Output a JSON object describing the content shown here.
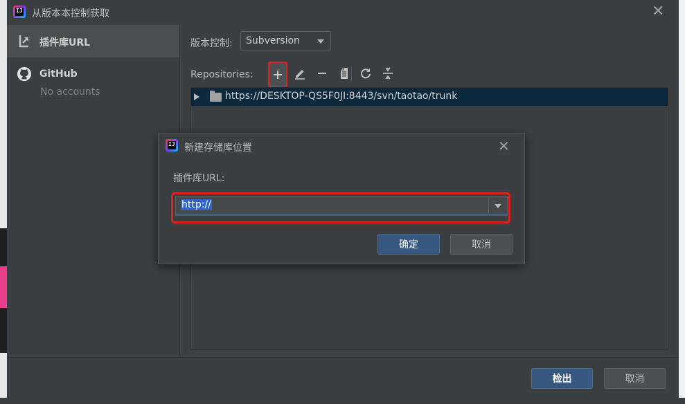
{
  "window": {
    "title": "从版本本控制获取"
  },
  "sidebar": {
    "items": [
      {
        "label": "插件库URL",
        "icon": "vcs-url-icon",
        "selected": true
      },
      {
        "label": "GitHub",
        "sublabel": "No accounts",
        "icon": "github-icon",
        "selected": false
      }
    ]
  },
  "main": {
    "vc_label": "版本控制:",
    "vc_select_value": "Subversion",
    "repositories_label": "Repositories:",
    "toolbar": [
      "add-icon",
      "edit-icon",
      "remove-icon",
      "browse-icon",
      "refresh-icon",
      "collapse-icon"
    ],
    "repositories": [
      {
        "url": "https://DESKTOP-QS5F0JI:8443/svn/taotao/trunk"
      }
    ]
  },
  "dialog": {
    "title": "新建存储库位置",
    "url_label": "插件库URL:",
    "url_value": "http://",
    "ok_label": "确定",
    "cancel_label": "取消"
  },
  "footer": {
    "checkout_label": "检出",
    "cancel_label": "取消"
  },
  "colors": {
    "highlight": "#e0201c",
    "primary_button": "#365880",
    "selection": "#0d293e"
  }
}
